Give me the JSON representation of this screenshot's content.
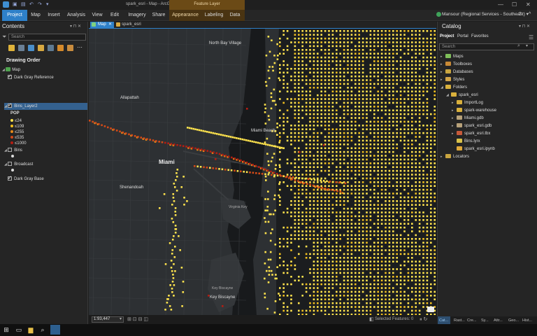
{
  "titlebar": {
    "title": "spark_esri - Map - ArcGIS Pro",
    "contextual_group": "Feature Layer",
    "min": "—",
    "max": "☐",
    "close": "✕",
    "quick_access": [
      "▣",
      "▤",
      "↶",
      "↷",
      "▾"
    ]
  },
  "ribbon": {
    "tabs": [
      "Project",
      "Map",
      "Insert",
      "Analysis",
      "View",
      "Edit",
      "Imagery",
      "Share",
      "Appearance",
      "Labeling",
      "Data"
    ],
    "user": "Mansour (Regional Services - Southeast) ▾",
    "help": "?",
    "collapse": "^"
  },
  "contents": {
    "title": "Contents",
    "pin": "▾ ⊓ ✕",
    "search_placeholder": "Search",
    "drawing_order": "Drawing Order",
    "layers": {
      "map": "Map",
      "dark_gray_reference": "Dark Gray Reference",
      "bins_layer2": "Bins_Layer2",
      "pop_label": "POP",
      "legend": [
        "≤24",
        "≤109",
        "≤255",
        "≤535",
        "≤1000"
      ],
      "bins": "Bins",
      "broadcast": "Broadcast",
      "dark_gray_base": "Dark Gray Base"
    },
    "legend_colors": [
      "#ffe34d",
      "#f2c01f",
      "#e88a1a",
      "#d44a17",
      "#b51d12"
    ]
  },
  "map": {
    "tabs": [
      "Map",
      "spark_esri"
    ],
    "close": "✕",
    "places": {
      "north_bay": "North Bay\nVillage",
      "allapattah": "Allapattah",
      "miami_beach": "Miami\nBeach",
      "miami": "Miami",
      "shenandoah": "Shenandoah",
      "virginia_key": "Virginia\nKey",
      "key_biscayne_small": "Key\nBiscayne",
      "key_biscayne": "Key\nBiscayne"
    },
    "scale": "1:93,447",
    "selected_features": "Selected Features: 0"
  },
  "catalog": {
    "title": "Catalog",
    "tabs": [
      "Project",
      "Portal",
      "Favorites"
    ],
    "search_placeholder": "Search",
    "items": {
      "maps": "Maps",
      "toolboxes": "Toolboxes",
      "databases": "Databases",
      "styles": "Styles",
      "folders": "Folders",
      "spark_esri": "spark_esri",
      "importlog": "ImportLog",
      "spark_warehouse": "spark-warehouse",
      "miami_gdb": "Miami.gdb",
      "spark_esri_gdb": "spark_esri.gdb",
      "spark_esri_tbx": "spark_esri.tbx",
      "bins_lyrx": "Bins.lyrx",
      "spark_esri_ipynb": "spark_esri.ipynb",
      "locators": "Locators"
    },
    "bottom_tabs": [
      "Cat...",
      "Rast...",
      "Cre...",
      "Sy...",
      "Attr...",
      "Geo...",
      "Hist..."
    ]
  },
  "taskbar": {
    "icons": [
      "start-icon",
      "task-view-icon",
      "file-explorer-icon",
      "search-icon",
      "arcgis-pro-icon"
    ]
  }
}
